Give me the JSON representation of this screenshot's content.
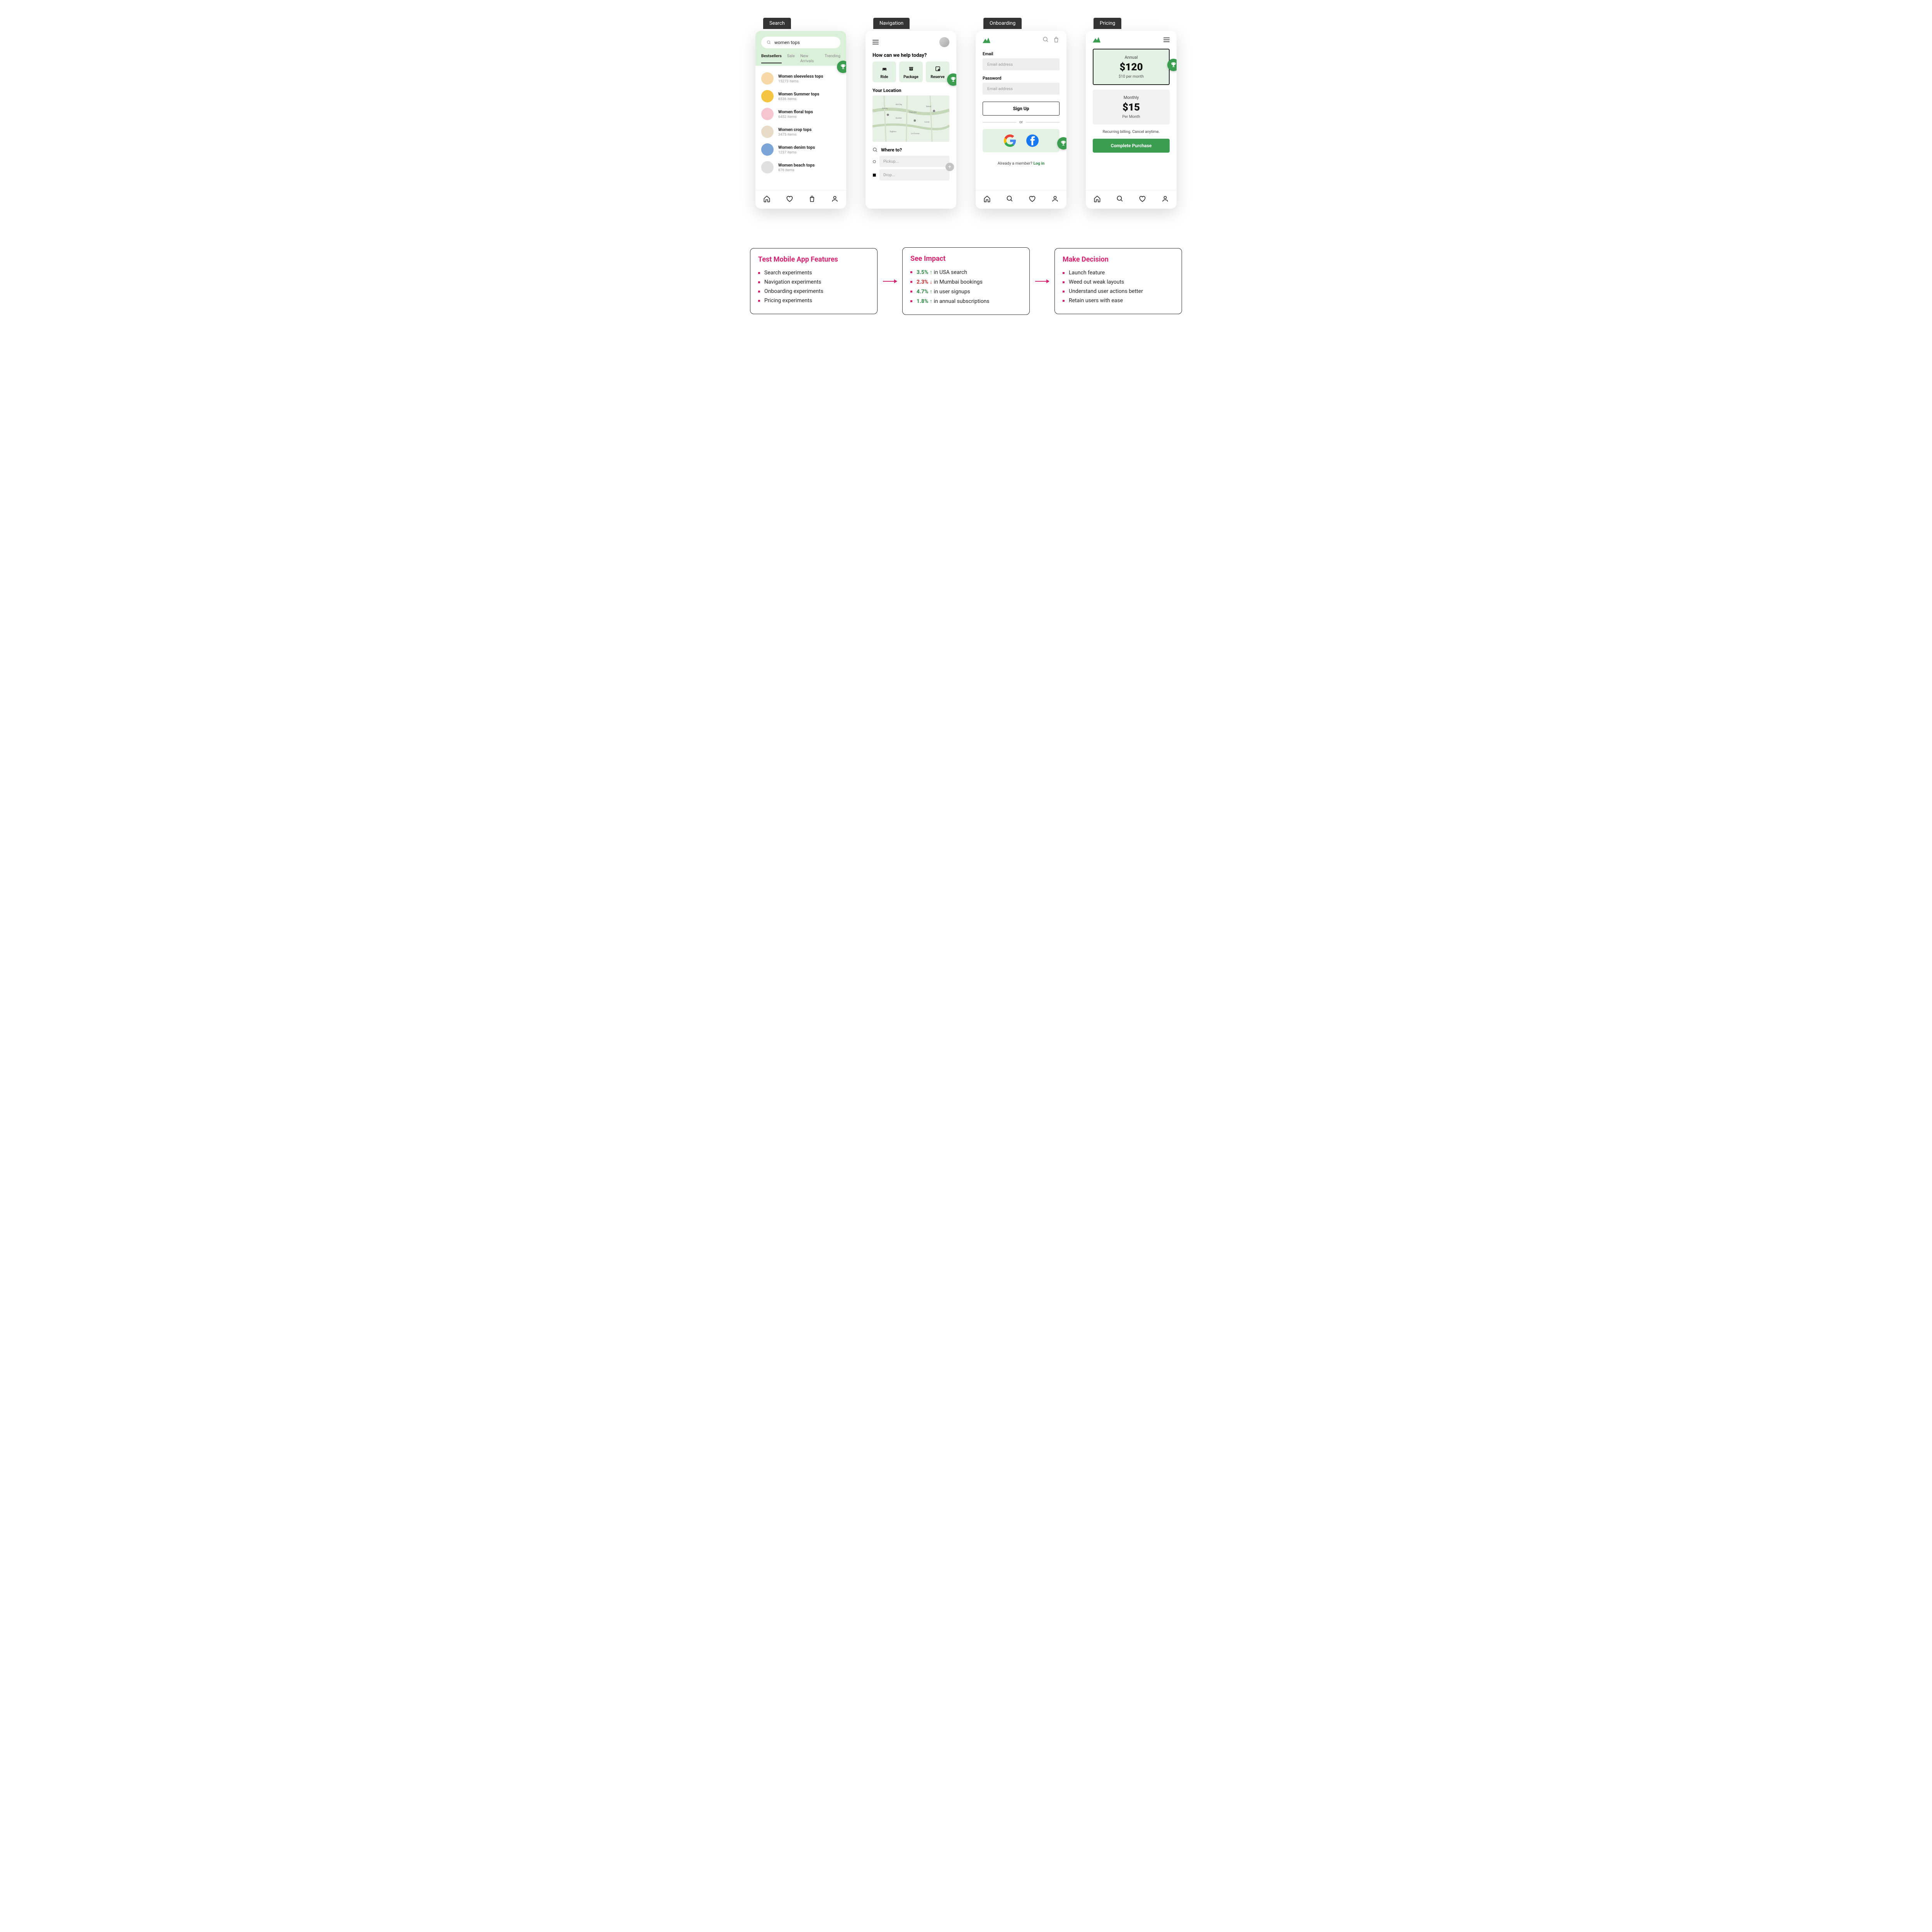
{
  "phones": {
    "search": {
      "tab": "Search",
      "query": "women tops",
      "tabs": [
        "Bestsellers",
        "Sale",
        "New Arrivals",
        "Trending"
      ],
      "items": [
        {
          "title": "Women sleeveless tops",
          "sub": "15273 items",
          "color": "#f7d9a8"
        },
        {
          "title": "Women Summer tops",
          "sub": "8536 items",
          "color": "#f5c542"
        },
        {
          "title": "Women floral tops",
          "sub": "6452 items",
          "color": "#f6c6d0"
        },
        {
          "title": "Women crop tops",
          "sub": "3475 items",
          "color": "#e8dcc9"
        },
        {
          "title": "Women denim tops",
          "sub": "1237 items",
          "color": "#7aa5d6"
        },
        {
          "title": "Women beach tops",
          "sub": "876 items",
          "color": "#e0e0e0"
        }
      ]
    },
    "navigation": {
      "tab": "Navigation",
      "title": "How can we help today?",
      "actions": [
        {
          "label": "Ride"
        },
        {
          "label": "Package"
        },
        {
          "label": "Reserve"
        }
      ],
      "location_label": "Your Location",
      "whereto": "Where to?",
      "pickup_ph": "Pickup...",
      "drop_ph": "Drop..."
    },
    "onboarding": {
      "tab": "Onboarding",
      "email_label": "Email",
      "email_ph": "Email address",
      "pw_label": "Password",
      "pw_ph": "Email address",
      "signup": "Sign Up",
      "or": "or",
      "member": "Already a member? ",
      "login": "Log in"
    },
    "pricing": {
      "tab": "Pricing",
      "annual": {
        "label": "Annual",
        "price": "$120",
        "sub": "$10 per month"
      },
      "monthly": {
        "label": "Monthly",
        "price": "$15",
        "sub": "Per Month"
      },
      "note": "Recurring billing. Cancel anytime.",
      "cta": "Complete Purchase"
    }
  },
  "boxes": {
    "b1": {
      "title": "Test Mobile App Features",
      "items": [
        "Search experiments",
        "Navigation experiments",
        "Onboarding experiments",
        "Pricing experiments"
      ]
    },
    "b2": {
      "title": "See Impact",
      "items": [
        {
          "pct": "3.5%",
          "dir": "up",
          "text": " in USA search"
        },
        {
          "pct": "2.3%",
          "dir": "down",
          "text": " in Mumbai bookings"
        },
        {
          "pct": "4.7%",
          "dir": "up",
          "text": " in user signups"
        },
        {
          "pct": "1.8%",
          "dir": "up",
          "text": " in annual subscriptions"
        }
      ]
    },
    "b3": {
      "title": "Make Decision",
      "items": [
        "Launch feature",
        "Weed out weak layouts",
        "Understand user actions better",
        "Retain users with ease"
      ]
    }
  }
}
